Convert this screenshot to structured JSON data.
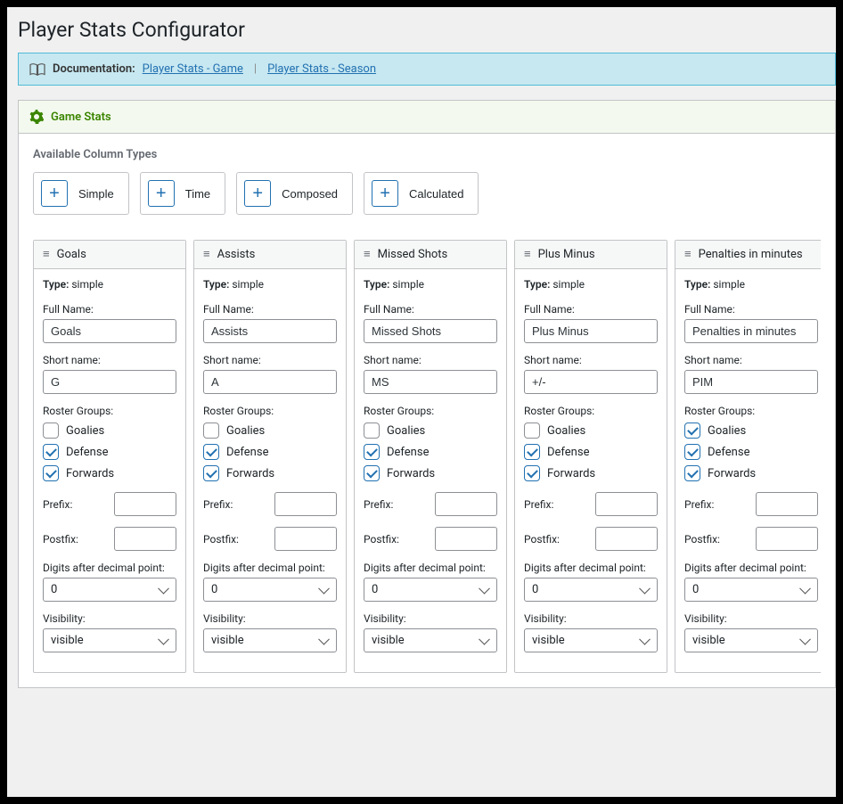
{
  "page_title": "Player Stats Configurator",
  "doc_bar": {
    "label": "Documentation:",
    "link1": "Player Stats - Game",
    "link2": "Player Stats - Season",
    "sep": "|"
  },
  "panel": {
    "title": "Game Stats",
    "available_label": "Available Column Types",
    "types": [
      {
        "label": "Simple"
      },
      {
        "label": "Time"
      },
      {
        "label": "Composed"
      },
      {
        "label": "Calculated"
      }
    ]
  },
  "labels": {
    "type_prefix": "Type:",
    "full_name": "Full Name:",
    "short_name": "Short name:",
    "roster_groups": "Roster Groups:",
    "rg_options": [
      "Goalies",
      "Defense",
      "Forwards"
    ],
    "prefix": "Prefix:",
    "postfix": "Postfix:",
    "digits": "Digits after decimal point:",
    "visibility": "Visibility:"
  },
  "columns": [
    {
      "title": "Goals",
      "type": "simple",
      "full_name": "Goals",
      "short_name": "G",
      "roster": [
        false,
        true,
        true
      ],
      "prefix": "",
      "postfix": "",
      "digits": "0",
      "visibility": "visible"
    },
    {
      "title": "Assists",
      "type": "simple",
      "full_name": "Assists",
      "short_name": "A",
      "roster": [
        false,
        true,
        true
      ],
      "prefix": "",
      "postfix": "",
      "digits": "0",
      "visibility": "visible"
    },
    {
      "title": "Missed Shots",
      "type": "simple",
      "full_name": "Missed Shots",
      "short_name": "MS",
      "roster": [
        false,
        true,
        true
      ],
      "prefix": "",
      "postfix": "",
      "digits": "0",
      "visibility": "visible"
    },
    {
      "title": "Plus Minus",
      "type": "simple",
      "full_name": "Plus Minus",
      "short_name": "+/-",
      "roster": [
        false,
        true,
        true
      ],
      "prefix": "",
      "postfix": "",
      "digits": "0",
      "visibility": "visible"
    },
    {
      "title": "Penalties in minutes",
      "type": "simple",
      "full_name": "Penalties in minutes",
      "short_name": "PIM",
      "roster": [
        true,
        true,
        true
      ],
      "prefix": "",
      "postfix": "",
      "digits": "0",
      "visibility": "visible"
    }
  ]
}
